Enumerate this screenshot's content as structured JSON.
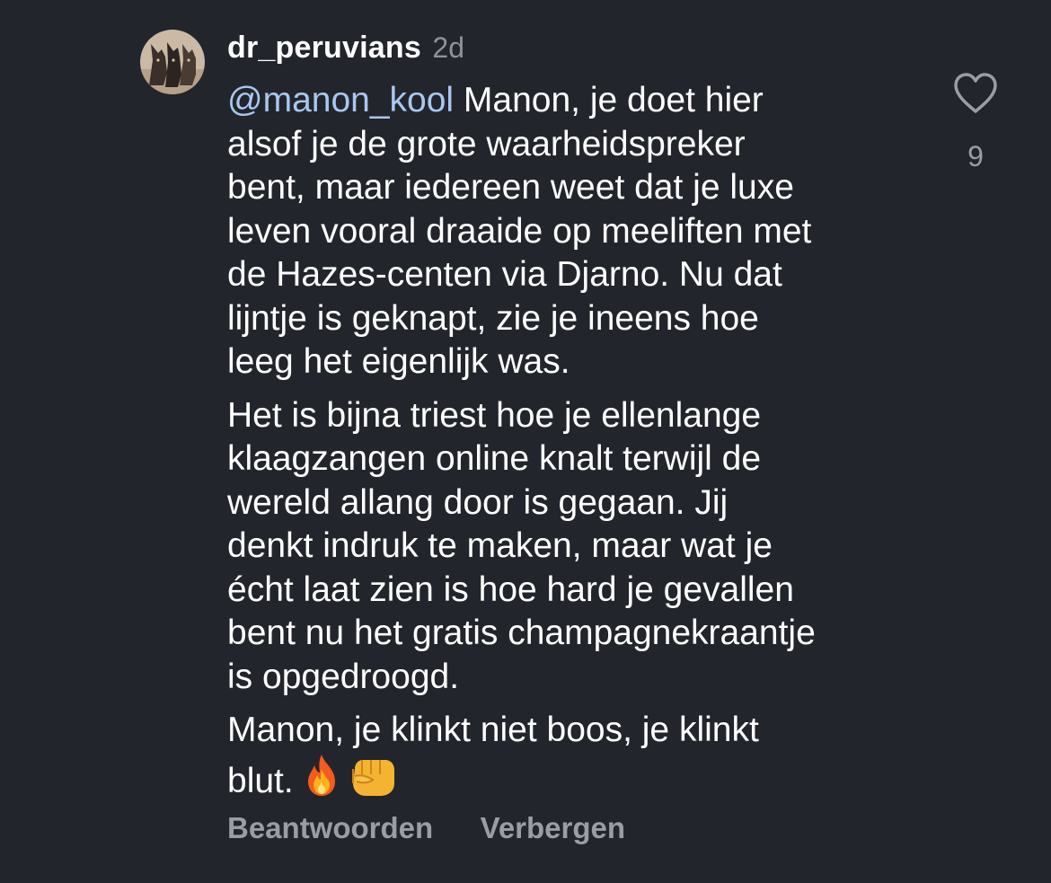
{
  "comment": {
    "username": "dr_peruvians",
    "timestamp": "2d",
    "mention": "@manon_kool",
    "paragraphs": [
      [
        " Manon, je doet hier",
        "alsof je de grote waarheidspreker",
        "bent, maar iedereen weet dat je luxe",
        "leven vooral draaide op meeliften met",
        "de Hazes-centen via Djarno. Nu dat",
        "lijntje is geknapt, zie je ineens hoe",
        "leeg het eigenlijk was."
      ],
      [
        "Het is bijna triest hoe je ellenlange",
        "klaagzangen online knalt terwijl de",
        "wereld allang door is gegaan. Jij",
        "denkt indruk te maken, maar wat je",
        "écht laat zien is hoe hard je gevallen",
        "bent nu het gratis champagnekraantje",
        "is opgedroogd."
      ],
      [
        "Manon, je klinkt niet boos, je klinkt",
        "blut."
      ]
    ],
    "emojis": [
      "fire-icon",
      "fist-icon"
    ],
    "like_count": "9",
    "actions": {
      "reply": "Beantwoorden",
      "hide": "Verbergen"
    }
  },
  "colors": {
    "background": "#23252c",
    "text": "#ffffff",
    "mention": "#a9c7f0",
    "muted": "#9a9da6"
  }
}
